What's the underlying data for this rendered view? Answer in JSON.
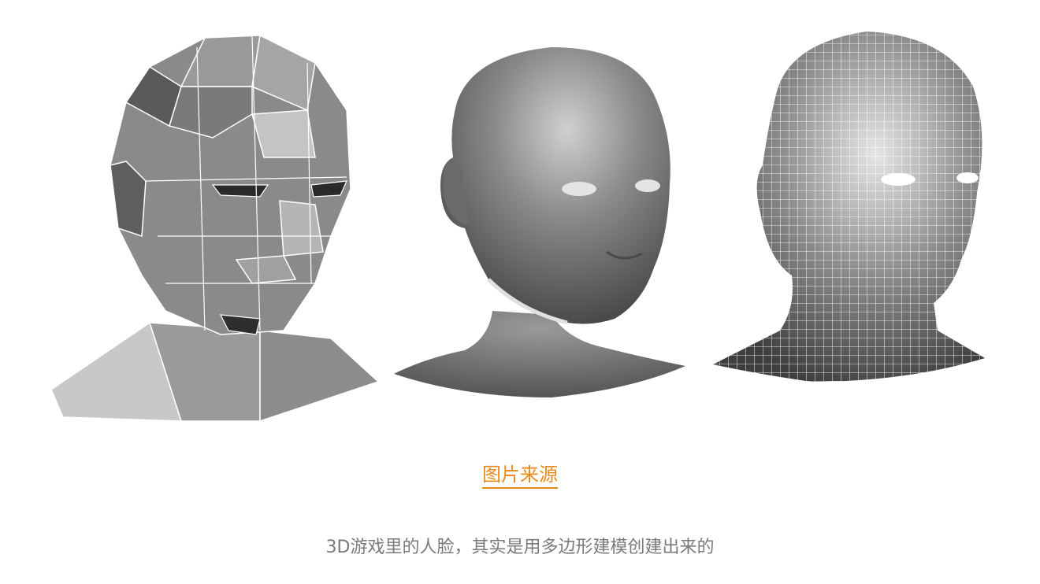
{
  "image": {
    "description_models": [
      "low-poly-head-model",
      "smooth-shaded-head-model",
      "high-poly-wireframe-head-model"
    ],
    "colors": {
      "surface": "#808080",
      "highlight": "#d8d8d8",
      "shadow": "#3a3a3a",
      "wire": "#ffffff"
    }
  },
  "source_link": {
    "label": "图片来源",
    "color": "#e8891a"
  },
  "caption": {
    "text": "3D游戏里的人脸，其实是用多边形建模创建出来的",
    "color": "#7a7a7a"
  }
}
